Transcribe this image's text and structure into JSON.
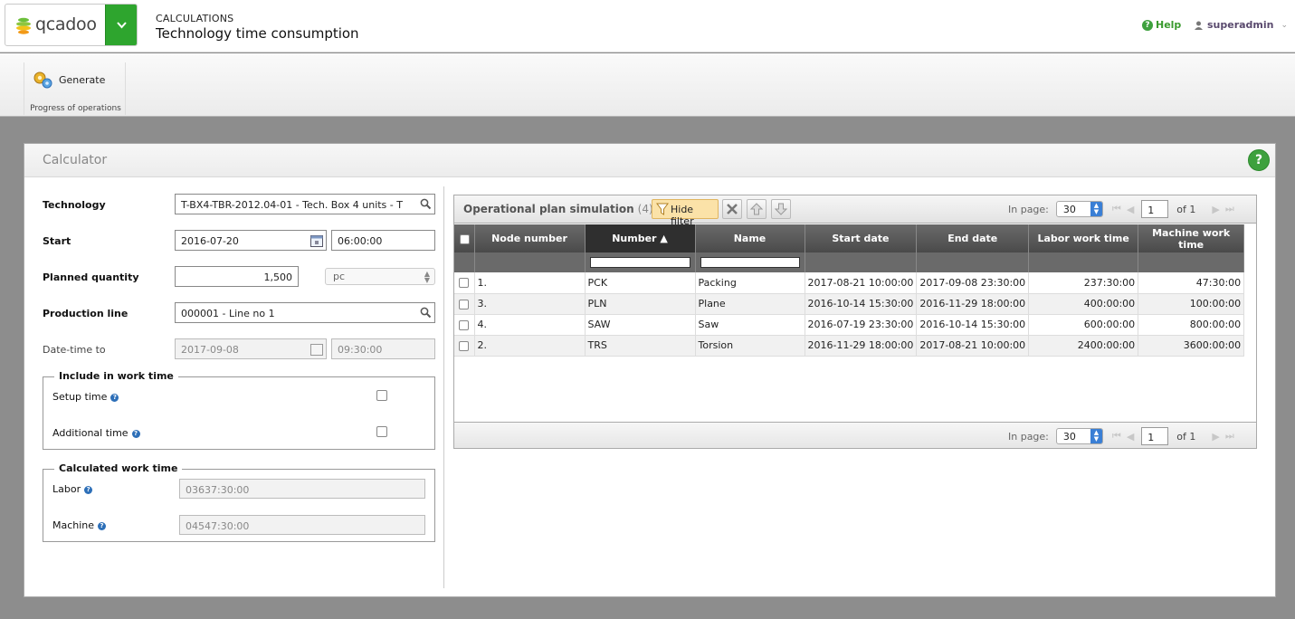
{
  "app": {
    "logo_text": "qcadoo",
    "section": "CALCULATIONS",
    "title": "Technology time consumption",
    "help_label": "Help",
    "user_label": "superadmin"
  },
  "ribbon": {
    "generate_label": "Generate",
    "group_label": "Progress of operations"
  },
  "calculator": {
    "title": "Calculator",
    "technology": {
      "label": "Technology",
      "value": "T-BX4-TBR-2012.04-01 - Tech. Box 4 units - T"
    },
    "start": {
      "label": "Start",
      "date": "2016-07-20",
      "time": "06:00:00"
    },
    "planned_quantity": {
      "label": "Planned quantity",
      "value": "1,500",
      "unit": "pc"
    },
    "production_line": {
      "label": "Production line",
      "value": "000001 - Line no 1"
    },
    "date_time_to": {
      "label": "Date-time to",
      "date": "2017-09-08",
      "time": "09:30:00"
    },
    "include": {
      "legend": "Include in work time",
      "setup_label": "Setup time",
      "additional_label": "Additional time"
    },
    "calculated": {
      "legend": "Calculated work time",
      "labor_label": "Labor",
      "labor_value": "03637:30:00",
      "machine_label": "Machine",
      "machine_value": "04547:30:00"
    }
  },
  "grid": {
    "title": "Operational plan simulation",
    "count": "(4)",
    "hide_filter_label": "Hide filter",
    "in_page_label": "In page:",
    "page_size": "30",
    "page_number": "1",
    "of_label": "of 1",
    "columns": [
      "Node number",
      "Number",
      "Name",
      "Start date",
      "End date",
      "Labor work time",
      "Machine work time"
    ],
    "rows": [
      {
        "node": "1.",
        "number": "PCK",
        "name": "Packing",
        "start": "2017-08-21 10:00:00",
        "end": "2017-09-08 23:30:00",
        "labor": "237:30:00",
        "machine": "47:30:00"
      },
      {
        "node": "3.",
        "number": "PLN",
        "name": "Plane",
        "start": "2016-10-14 15:30:00",
        "end": "2016-11-29 18:00:00",
        "labor": "400:00:00",
        "machine": "100:00:00"
      },
      {
        "node": "4.",
        "number": "SAW",
        "name": "Saw",
        "start": "2016-07-19 23:30:00",
        "end": "2016-10-14 15:30:00",
        "labor": "600:00:00",
        "machine": "800:00:00"
      },
      {
        "node": "2.",
        "number": "TRS",
        "name": "Torsion",
        "start": "2016-11-29 18:00:00",
        "end": "2017-08-21 10:00:00",
        "labor": "2400:00:00",
        "machine": "3600:00:00"
      }
    ]
  }
}
